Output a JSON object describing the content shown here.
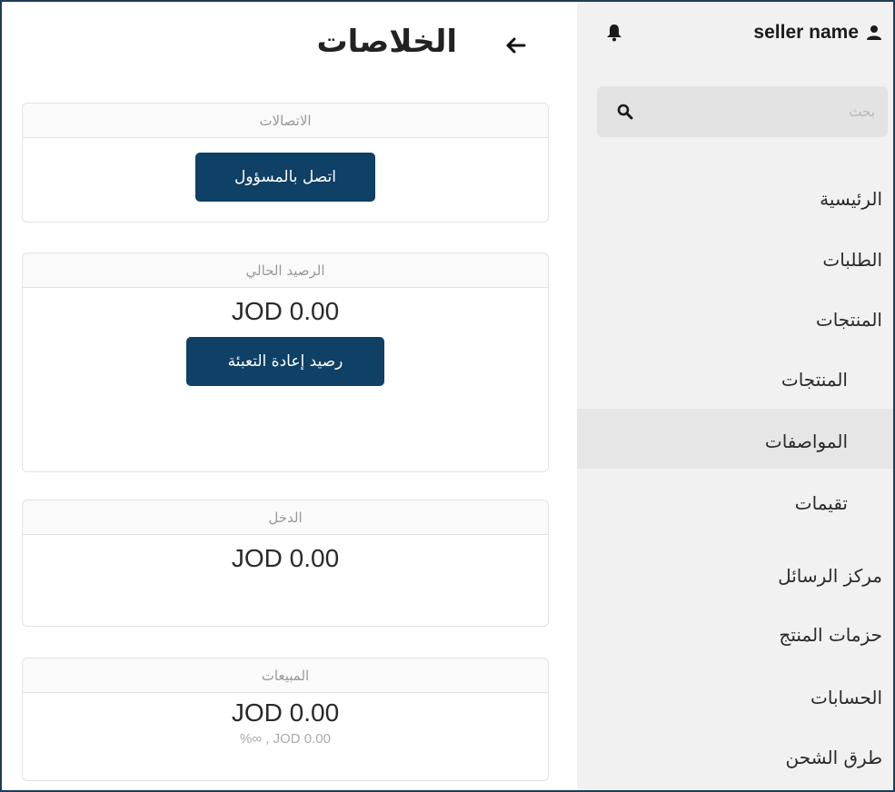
{
  "sidebar": {
    "seller_name": "seller name",
    "search_placeholder": "بحث",
    "items": [
      {
        "label": "الرئيسية"
      },
      {
        "label": "الطلبات"
      },
      {
        "label": "المنتجات"
      },
      {
        "label": "المنتجات"
      },
      {
        "label": "المواصفات"
      },
      {
        "label": "تقيمات"
      },
      {
        "label": "مركز الرسائل"
      },
      {
        "label": "حزمات المنتج"
      },
      {
        "label": "الحسابات"
      },
      {
        "label": "طرق الشحن"
      }
    ]
  },
  "header": {
    "title": "الخلاصات"
  },
  "cards": {
    "contacts": {
      "title": "الاتصالات",
      "button": "اتصل بالمسؤول"
    },
    "balance": {
      "title": "الرصيد الحالي",
      "amount": "JOD 0.00",
      "button": "رصيد إعادة التعبئة"
    },
    "income": {
      "title": "الدخل",
      "amount": "JOD 0.00"
    },
    "sales": {
      "title": "المبيعات",
      "amount": "JOD 0.00",
      "sub": "%∞ , JOD 0.00"
    }
  },
  "colors": {
    "primary": "#0f4065",
    "sidebar_bg": "#f1f1f1",
    "active_bg": "#e6e6e6",
    "border": "#1d3c5a"
  },
  "icons": [
    "user-icon",
    "bell-icon",
    "search-icon",
    "back-arrow-icon"
  ]
}
